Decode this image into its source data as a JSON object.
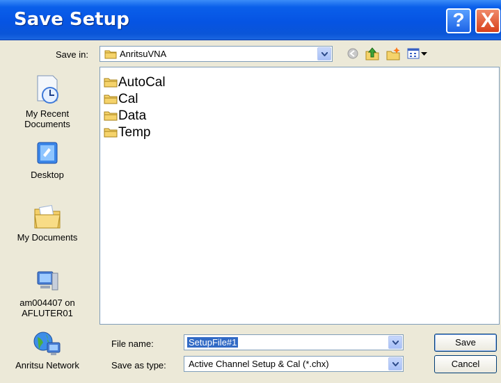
{
  "window": {
    "title": "Save Setup"
  },
  "toolbar": {
    "save_in_label": "Save in:",
    "save_in_value": "AnritsuVNA"
  },
  "places": [
    {
      "label": "My Recent Documents"
    },
    {
      "label": "Desktop"
    },
    {
      "label": "My Documents"
    },
    {
      "label": "am004407 on AFLUTER01"
    },
    {
      "label": "Anritsu Network"
    }
  ],
  "files": [
    {
      "name": "AutoCal"
    },
    {
      "name": "Cal"
    },
    {
      "name": "Data"
    },
    {
      "name": "Temp"
    }
  ],
  "form": {
    "file_name_label": "File name:",
    "file_name_value": "SetupFile#1",
    "save_as_type_label": "Save as type:",
    "save_as_type_value": "Active Channel Setup & Cal (*.chx)"
  },
  "buttons": {
    "save": "Save",
    "cancel": "Cancel",
    "help": "?",
    "close": "X"
  }
}
